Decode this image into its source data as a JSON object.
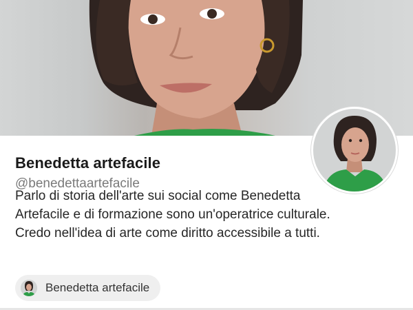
{
  "profile": {
    "display_name": "Benedetta artefacile",
    "handle": "@benedettaartefacile",
    "bio_lines": [
      "Parlo di storia dell'arte sui social come Benedetta",
      "Artefacile e di formazione sono un'operatrice culturale.",
      "Credo nell'idea di arte come diritto accessibile a tutti."
    ]
  },
  "account_chip": {
    "label": "Benedetta artefacile",
    "icon": "profile-avatar-icon"
  },
  "images": {
    "cover": "cover-photo-portrait",
    "avatar": "profile-avatar-portrait"
  },
  "colors": {
    "shirt_green": "#2e9e48",
    "chip_background": "#efefef",
    "handle_gray": "#7a7a7a"
  }
}
